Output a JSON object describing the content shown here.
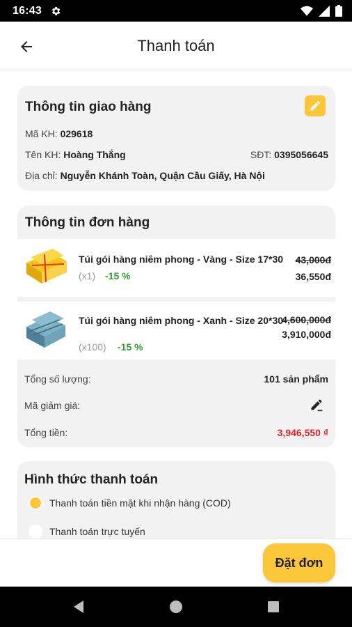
{
  "status_bar": {
    "time": "16:43"
  },
  "header": {
    "title": "Thanh toán"
  },
  "shipping": {
    "title": "Thông tin giao hàng",
    "customer_id_label": "Mã KH:",
    "customer_id": "029618",
    "customer_name_label": "Tên KH:",
    "customer_name": "Hoàng Thắng",
    "phone_label": "SĐT:",
    "phone": "0395056645",
    "address_label": "Địa chỉ:",
    "address": "Nguyễn Khánh Toàn, Quận Cầu Giấy, Hà Nội"
  },
  "order": {
    "title": "Thông tin đơn hàng",
    "items": [
      {
        "name": "Túi gói hàng niêm phong - Vàng - Size 17*30",
        "qty": "(x1)",
        "discount": "-15 %",
        "old_price": "43,000đ",
        "new_price": "36,550đ",
        "color": "#f5c518"
      },
      {
        "name": "Túi gói hàng niêm phong - Xanh - Size 20*30",
        "qty": "(x100)",
        "discount": "-15 %",
        "old_price": "4,600,000đ",
        "new_price": "3,910,000đ",
        "color": "#6fa3b8"
      }
    ],
    "total_qty_label": "Tổng số lượng:",
    "total_qty": "101 sản phẩm",
    "coupon_label": "Mã giảm giá:",
    "total_label": "Tổng tiền:",
    "total": "3,946,550 ₫"
  },
  "payment": {
    "title": "Hình thức thanh toán",
    "options": [
      {
        "label": "Thanh toán tiền mặt khi nhận hàng (COD)",
        "selected": true
      },
      {
        "label": "Thanh toán trực tuyến",
        "selected": false
      }
    ]
  },
  "footer": {
    "order_button": "Đặt đơn"
  },
  "colors": {
    "accent": "#fcc63a",
    "discount": "#2e9b2e",
    "total": "#e2242a"
  }
}
